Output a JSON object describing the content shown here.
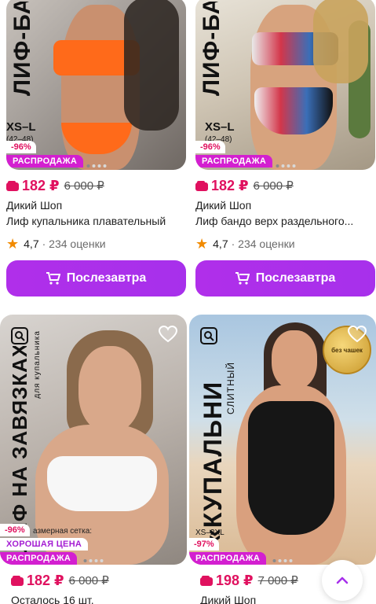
{
  "cards": [
    {
      "photo_text": "ЛИФ-БА",
      "size_main": "XS–L",
      "size_sub": "(42–48)",
      "discount": "-96%",
      "badge": "РАСПРОДАЖА",
      "price": "182 ₽",
      "old_price": "6 000 ₽",
      "brand": "Дикий Шоп",
      "title": "Лиф купальника плавательный",
      "rating": "4,7",
      "reviews": "· 234 оценки",
      "button": "Послезавтра"
    },
    {
      "photo_text": "ЛИФ-БА",
      "size_main": "XS–L",
      "size_sub": "(42–48)",
      "discount": "-96%",
      "badge": "РАСПРОДАЖА",
      "price": "182 ₽",
      "old_price": "6 000 ₽",
      "brand": "Дикий Шоп",
      "title": "Лиф бандо верх раздельного...",
      "rating": "4,7",
      "reviews": "· 234 оценки",
      "button": "Послезавтра"
    },
    {
      "photo_text": "ЛИФ НА ЗАВЯЗКАХ",
      "photo_sub": "для купальника",
      "photo_note": "азмерная сетка:",
      "discount": "-96%",
      "good_badge": "ХОРОШАЯ ЦЕНА",
      "badge": "РАСПРОДАЖА",
      "price": "182 ₽",
      "old_price": "6 000 ₽",
      "stock": "Осталось 16 шт."
    },
    {
      "photo_text": "«КУПАЛЬНИ",
      "photo_sub": "СЛИТНЫЙ",
      "seal_text": "без чашек",
      "size_main": "XS–2XL",
      "discount": "-97%",
      "badge": "РАСПРОДАЖА",
      "price": "198 ₽",
      "old_price": "7 000 ₽",
      "brand": "Дикий Шоп"
    }
  ],
  "colors": {
    "accent": "#a730eb",
    "price": "#e0115f",
    "badge": "#d31fd0",
    "star": "#f18a00"
  },
  "icons": [
    "wallet-icon",
    "star-icon",
    "cart-icon",
    "heart-icon",
    "image-search-icon",
    "chevron-up-icon"
  ]
}
